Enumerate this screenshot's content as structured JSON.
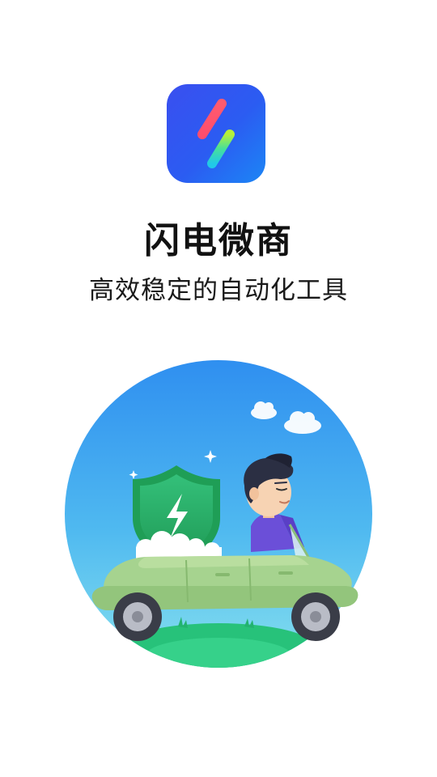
{
  "splash": {
    "app_name": "闪电微商",
    "tagline": "高效稳定的自动化工具"
  },
  "icons": {
    "app_logo": "lightning-bolt-logo-icon",
    "illustration": "car-driver-shield-illustration"
  },
  "colors": {
    "background": "#ffffff",
    "icon_gradient_start": "#3a4ff0",
    "icon_gradient_end": "#1c86f5",
    "sky_top": "#2f8ff0",
    "sky_bottom": "#7fdbee",
    "car_body": "#a6d38f",
    "shield": "#2fb46a"
  }
}
